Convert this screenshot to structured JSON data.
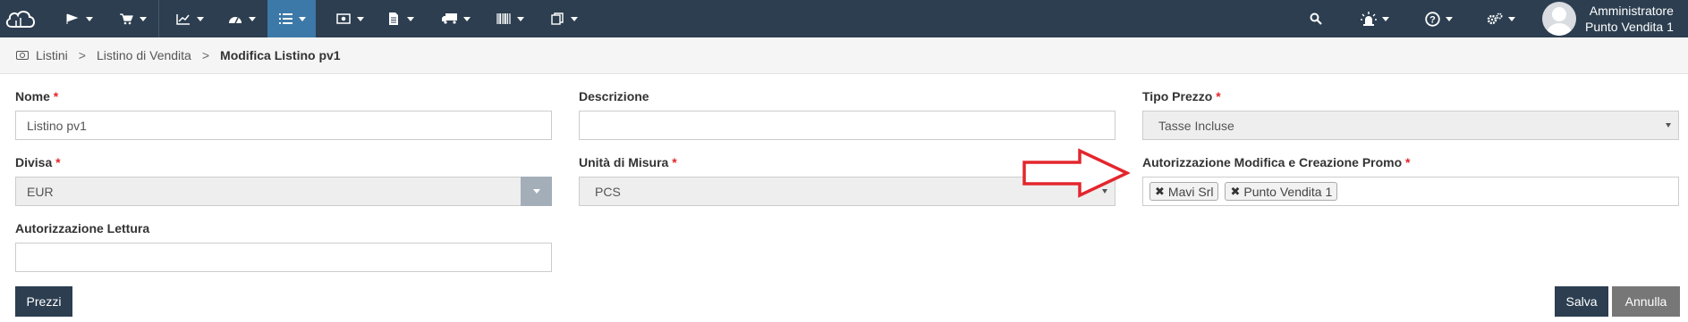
{
  "navbar": {
    "items": [
      {
        "name": "menu-documents",
        "icon": "flag-icon"
      },
      {
        "name": "menu-sales",
        "icon": "cart-icon"
      },
      {
        "name": "menu-statistics",
        "icon": "line-chart-icon"
      },
      {
        "name": "menu-dashboard",
        "icon": "dashboard-icon"
      },
      {
        "name": "menu-lists",
        "icon": "list-icon",
        "active": true
      },
      {
        "name": "menu-pricing",
        "icon": "money-icon"
      },
      {
        "name": "menu-files",
        "icon": "file-icon"
      },
      {
        "name": "menu-delivery",
        "icon": "truck-icon"
      },
      {
        "name": "menu-barcode",
        "icon": "barcode-icon"
      },
      {
        "name": "menu-copy",
        "icon": "copy-icon"
      }
    ],
    "right_icons": [
      "search-icon",
      "alarm-icon",
      "help-icon",
      "cogs-icon"
    ]
  },
  "user": {
    "name": "Amministratore",
    "store": "Punto Vendita 1"
  },
  "breadcrumb": {
    "items": [
      "Listini",
      "Listino di Vendita"
    ],
    "separator": ">",
    "current": "Modifica Listino pv1"
  },
  "form": {
    "nome": {
      "label": "Nome",
      "required": "*",
      "value": "Listino pv1"
    },
    "descrizione": {
      "label": "Descrizione",
      "value": ""
    },
    "tipo_prezzo": {
      "label": "Tipo Prezzo",
      "required": "*",
      "value": "Tasse Incluse"
    },
    "divisa": {
      "label": "Divisa",
      "required": "*",
      "value": "EUR"
    },
    "unita_misura": {
      "label": "Unità di Misura",
      "required": "*",
      "value": "PCS"
    },
    "autorizzazione_modifica": {
      "label": "Autorizzazione Modifica e Creazione Promo",
      "required": "*",
      "tags": [
        "Mavi Srl",
        "Punto Vendita 1"
      ]
    },
    "autorizzazione_lettura": {
      "label": "Autorizzazione Lettura",
      "value": ""
    }
  },
  "buttons": {
    "prezzi": "Prezzi",
    "salva": "Salva",
    "annulla": "Annulla"
  },
  "colors": {
    "navbar": "#2c3e50",
    "active_tab": "#3c78a8",
    "required": "#e3262d",
    "annotation_arrow": "#e3262d"
  }
}
